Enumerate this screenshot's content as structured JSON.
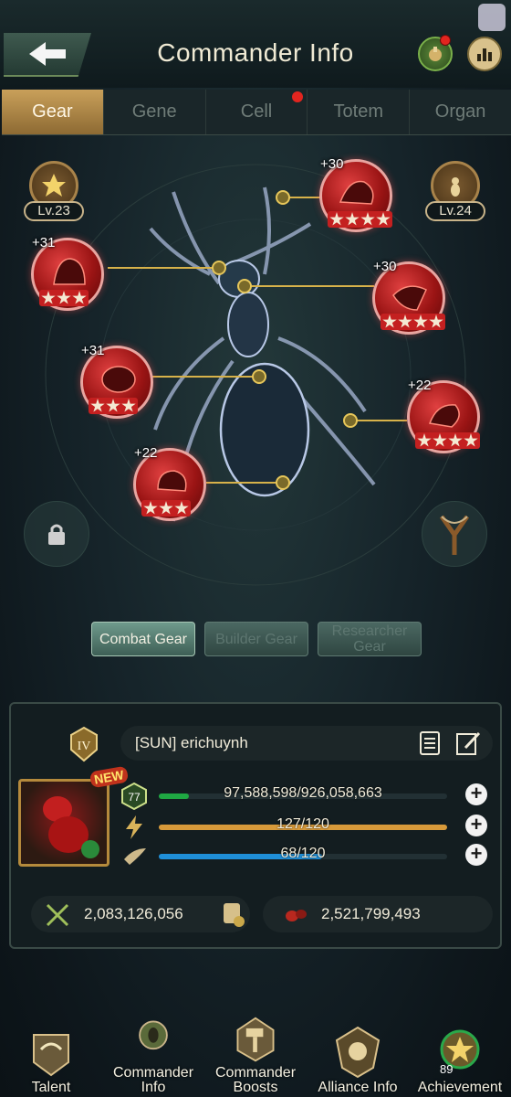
{
  "header": {
    "title": "Commander Info"
  },
  "tabs": [
    {
      "label": "Gear",
      "active": true
    },
    {
      "label": "Gene",
      "active": false
    },
    {
      "label": "Cell",
      "active": false,
      "dot": true
    },
    {
      "label": "Totem",
      "active": false
    },
    {
      "label": "Organ",
      "active": false
    }
  ],
  "badges": {
    "left_level": "Lv.23",
    "right_level": "Lv.24"
  },
  "gear_slots": [
    {
      "plus": "+31"
    },
    {
      "plus": "+30"
    },
    {
      "plus": "+30"
    },
    {
      "plus": "+31"
    },
    {
      "plus": "+22"
    },
    {
      "plus": "+22"
    }
  ],
  "gear_types": [
    "Combat Gear",
    "Builder Gear",
    "Researcher Gear"
  ],
  "commander": {
    "name": "[SUN]  erichuynh",
    "level": "77",
    "exp": "97,588,598/926,058,663",
    "exp_fraction": 0.105,
    "energy": "127/120",
    "energy_fraction": 1.0,
    "stamina": "68/120",
    "stamina_fraction": 0.567,
    "might": "2,083,126,056",
    "kills": "2,521,799,493",
    "new_badge": "NEW"
  },
  "bottom_nav": [
    {
      "label": "Talent"
    },
    {
      "label": "Commander Info"
    },
    {
      "label": "Commander Boosts"
    },
    {
      "label": "Alliance Info"
    },
    {
      "label": "Achievement",
      "count": "89"
    }
  ],
  "colors": {
    "accent": "#c9a05a",
    "exp": "#1fa843",
    "energy": "#d89a3a",
    "stamina": "#1f8fd8"
  }
}
